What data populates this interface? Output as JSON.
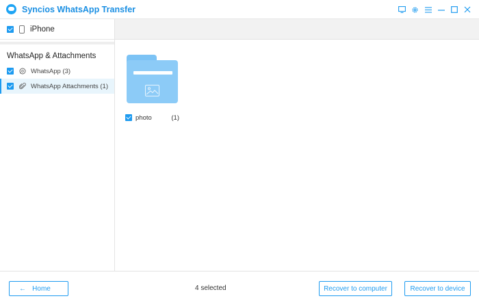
{
  "window": {
    "title": "Syncios WhatsApp Transfer",
    "accent_color": "#1e9bf0"
  },
  "sidebar": {
    "device": {
      "name": "iPhone",
      "checked": true,
      "icon": "phone-icon"
    },
    "section_title": "WhatsApp & Attachments",
    "items": [
      {
        "label": "WhatsApp (3)",
        "checked": true,
        "icon": "whatsapp-icon",
        "active": false
      },
      {
        "label": "WhatsApp Attachments (1)",
        "checked": true,
        "icon": "paperclip-icon",
        "active": true
      }
    ]
  },
  "main": {
    "folder": {
      "icon": "folder-image-icon",
      "label": "photo",
      "count": "(1)",
      "checked": true
    }
  },
  "footer": {
    "home_label": "Home",
    "selected_text": "4 selected",
    "recover_computer_label": "Recover to computer",
    "recover_device_label": "Recover to device"
  }
}
